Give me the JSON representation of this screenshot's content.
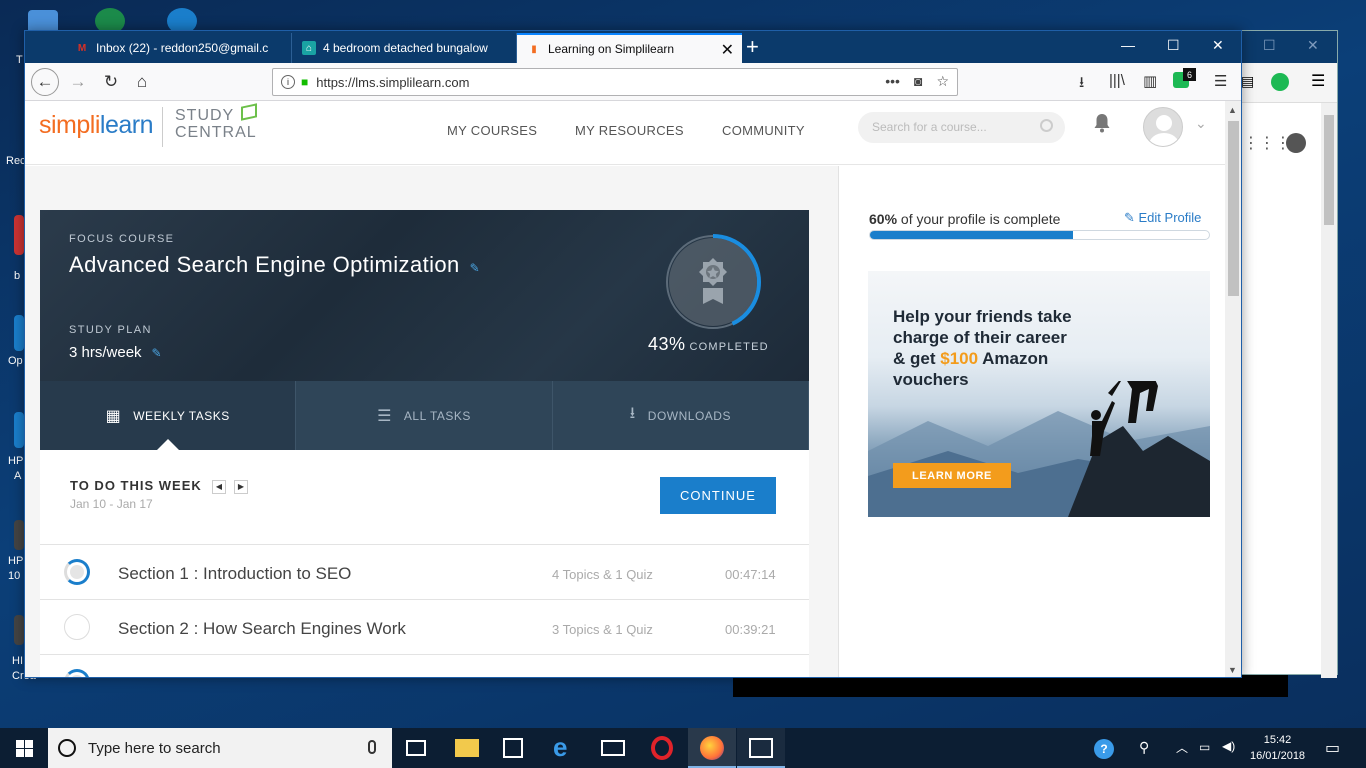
{
  "desktop": {
    "labels": [
      "T",
      "Rec",
      "b",
      "Op",
      "HP",
      "A",
      "HP",
      "10",
      "HI",
      "Crea"
    ]
  },
  "browser": {
    "tabs": [
      {
        "favicon": "gmail-icon",
        "label": "Inbox (22) - reddon250@gmail.c"
      },
      {
        "favicon": "house-icon",
        "label": "4 bedroom detached bungalow"
      },
      {
        "favicon": "simplilearn-icon",
        "label": "Learning on Simplilearn",
        "active": true
      }
    ],
    "new_tab": "+",
    "url": "https://lms.simplilearn.com",
    "extension_badge": "6"
  },
  "site": {
    "logo_simpl": "simpl",
    "logo_i": "i",
    "logo_learn": "learn",
    "study_central_1": "STUDY",
    "study_central_2": "CENTRAL",
    "nav": [
      "MY COURSES",
      "MY RESOURCES",
      "COMMUNITY"
    ],
    "search_placeholder": "Search for a course..."
  },
  "focus": {
    "label": "FOCUS COURSE",
    "title": "Advanced Search Engine Optimization",
    "plan_label": "STUDY PLAN",
    "plan_value": "3 hrs/week",
    "percent_text": "43%",
    "percent_value": 0.43,
    "completed_label": "COMPLETED"
  },
  "course_tabs": [
    {
      "icon": "calendar-icon",
      "label": "WEEKLY TASKS"
    },
    {
      "icon": "list-icon",
      "label": "ALL TASKS"
    },
    {
      "icon": "download-icon",
      "label": "DOWNLOADS"
    }
  ],
  "todo": {
    "heading": "TO DO THIS WEEK",
    "dates": "Jan 10 - Jan 17",
    "continue_label": "CONTINUE",
    "sections": [
      {
        "name": "Section 1 : Introduction to SEO",
        "topics": "4 Topics & 1 Quiz",
        "time": "00:47:14"
      },
      {
        "name": "Section 2 : How Search Engines Work",
        "topics": "3 Topics & 1 Quiz",
        "time": "00:39:21"
      }
    ]
  },
  "profile": {
    "percent_text": "60%",
    "suffix": " of your profile is complete",
    "edit_label": "Edit Profile",
    "fill_value": 0.6
  },
  "ad": {
    "line1": "Help your friends take",
    "line2": "charge of their career",
    "line3a": "& get ",
    "line3b": "$100",
    "line3c": " Amazon",
    "line4": "vouchers",
    "cta": "LEARN MORE"
  },
  "taskbar": {
    "search_placeholder": "Type here to search",
    "time": "15:42",
    "date": "16/01/2018"
  },
  "colors": {
    "accent": "#1a7ecb",
    "brand_orange": "#f36d21",
    "hero_dark": "#263747"
  }
}
